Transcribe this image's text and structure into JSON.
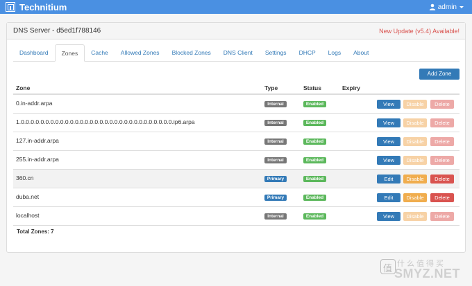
{
  "app": {
    "brand": "Technitium",
    "user_label": "admin"
  },
  "panel": {
    "title": "DNS Server - d5ed1f788146",
    "update_notice": "New Update (v5.4) Available!"
  },
  "tabs": [
    {
      "label": "Dashboard",
      "active": false
    },
    {
      "label": "Zones",
      "active": true
    },
    {
      "label": "Cache",
      "active": false
    },
    {
      "label": "Allowed Zones",
      "active": false
    },
    {
      "label": "Blocked Zones",
      "active": false
    },
    {
      "label": "DNS Client",
      "active": false
    },
    {
      "label": "Settings",
      "active": false
    },
    {
      "label": "DHCP",
      "active": false
    },
    {
      "label": "Logs",
      "active": false
    },
    {
      "label": "About",
      "active": false
    }
  ],
  "zones": {
    "add_label": "Add Zone",
    "columns": {
      "zone": "Zone",
      "type": "Type",
      "status": "Status",
      "expiry": "Expiry"
    },
    "rows": [
      {
        "zone": "0.in-addr.arpa",
        "type": "Internal",
        "status": "Enabled",
        "expiry": "",
        "action1": "View",
        "action2": "Disable",
        "action3": "Delete"
      },
      {
        "zone": "1.0.0.0.0.0.0.0.0.0.0.0.0.0.0.0.0.0.0.0.0.0.0.0.0.0.0.0.0.0.0.0.ip6.arpa",
        "type": "Internal",
        "status": "Enabled",
        "expiry": "",
        "action1": "View",
        "action2": "Disable",
        "action3": "Delete"
      },
      {
        "zone": "127.in-addr.arpa",
        "type": "Internal",
        "status": "Enabled",
        "expiry": "",
        "action1": "View",
        "action2": "Disable",
        "action3": "Delete"
      },
      {
        "zone": "255.in-addr.arpa",
        "type": "Internal",
        "status": "Enabled",
        "expiry": "",
        "action1": "View",
        "action2": "Disable",
        "action3": "Delete"
      },
      {
        "zone": "360.cn",
        "type": "Primary",
        "status": "Enabled",
        "expiry": "",
        "action1": "Edit",
        "action2": "Disable",
        "action3": "Delete"
      },
      {
        "zone": "duba.net",
        "type": "Primary",
        "status": "Enabled",
        "expiry": "",
        "action1": "Edit",
        "action2": "Disable",
        "action3": "Delete"
      },
      {
        "zone": "localhost",
        "type": "Internal",
        "status": "Enabled",
        "expiry": "",
        "action1": "View",
        "action2": "Disable",
        "action3": "Delete"
      }
    ],
    "total_label": "Total Zones: 7"
  },
  "watermark": {
    "chinese": "什么值得买",
    "domain": "SMYZ.NET"
  },
  "colors": {
    "navbar": "#4a90e2",
    "primary": "#337ab7",
    "success": "#5cb85c",
    "warning": "#f0ad4e",
    "danger": "#d9534f",
    "internal": "#777777"
  },
  "icons": [
    "logo-icon",
    "user-icon",
    "caret-down-icon"
  ]
}
